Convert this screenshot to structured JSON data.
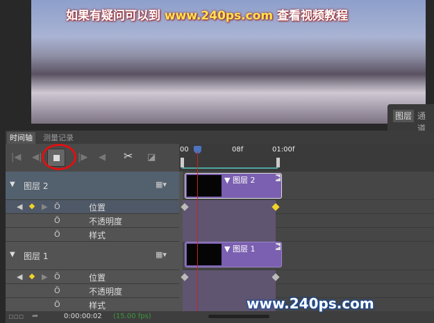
{
  "banner": {
    "pre": "如果有疑问可以到",
    "url": "www.240ps.com",
    "post": "查看视频教程"
  },
  "side_tabs": [
    "图层",
    "通道"
  ],
  "tabs": [
    {
      "label": "时间轴",
      "active": true
    },
    {
      "label": "测量记录",
      "active": false
    }
  ],
  "ruler": {
    "ticks": [
      "00",
      "08f",
      "01:00f"
    ]
  },
  "layers": [
    {
      "name": "图层 2",
      "clip_label": "图层 2",
      "props": [
        {
          "label": "位置",
          "keyframed": true
        },
        {
          "label": "不透明度"
        },
        {
          "label": "样式"
        }
      ]
    },
    {
      "name": "图层 1",
      "clip_label": "图层 1",
      "props": [
        {
          "label": "位置",
          "keyframed": true
        },
        {
          "label": "不透明度"
        },
        {
          "label": "样式"
        }
      ]
    }
  ],
  "bottom": {
    "timecode": "0:00:00:02",
    "fps": "(15.00 fps)"
  },
  "watermark": "www.240ps.com"
}
